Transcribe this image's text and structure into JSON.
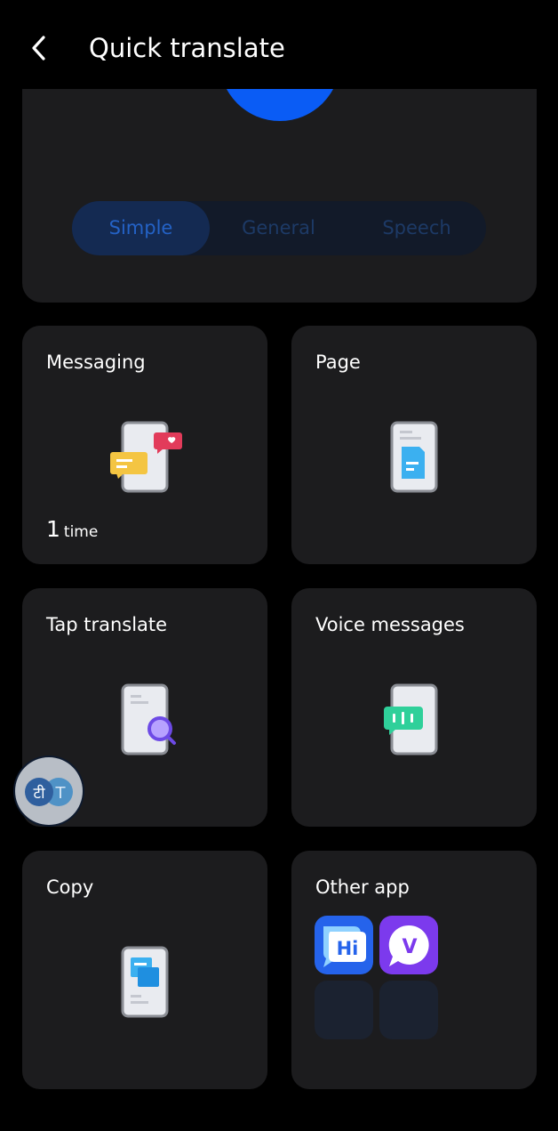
{
  "header": {
    "title": "Quick translate",
    "back_icon": "arrow-left-icon"
  },
  "mode_tabs": {
    "items": [
      {
        "label": "Simple",
        "active": true
      },
      {
        "label": "General",
        "active": false
      },
      {
        "label": "Speech",
        "active": false
      }
    ]
  },
  "features": {
    "messaging": {
      "title": "Messaging",
      "usage_count": "1",
      "usage_unit": "time",
      "icon": "phone-chat-bubbles-icon"
    },
    "page": {
      "title": "Page",
      "icon": "phone-document-icon"
    },
    "tap_translate": {
      "title": "Tap translate",
      "icon": "phone-search-icon"
    },
    "voice_messages": {
      "title": "Voice messages",
      "icon": "phone-voice-bubble-icon"
    },
    "copy": {
      "title": "Copy",
      "icon": "phone-copy-icon"
    },
    "other_app": {
      "title": "Other app",
      "apps": [
        {
          "label": "Hi",
          "icon": "hi-translate-app-icon",
          "color": "#2563eb"
        },
        {
          "label": "V",
          "icon": "v-app-icon",
          "color": "#7c3aed"
        }
      ]
    }
  },
  "floating_button": {
    "left_glyph": "टी",
    "right_glyph": "T",
    "icon": "translate-bubble-icon"
  },
  "colors": {
    "accent": "#0a5cf5",
    "card_bg": "#1c1c1e",
    "page_bg": "#000000"
  }
}
